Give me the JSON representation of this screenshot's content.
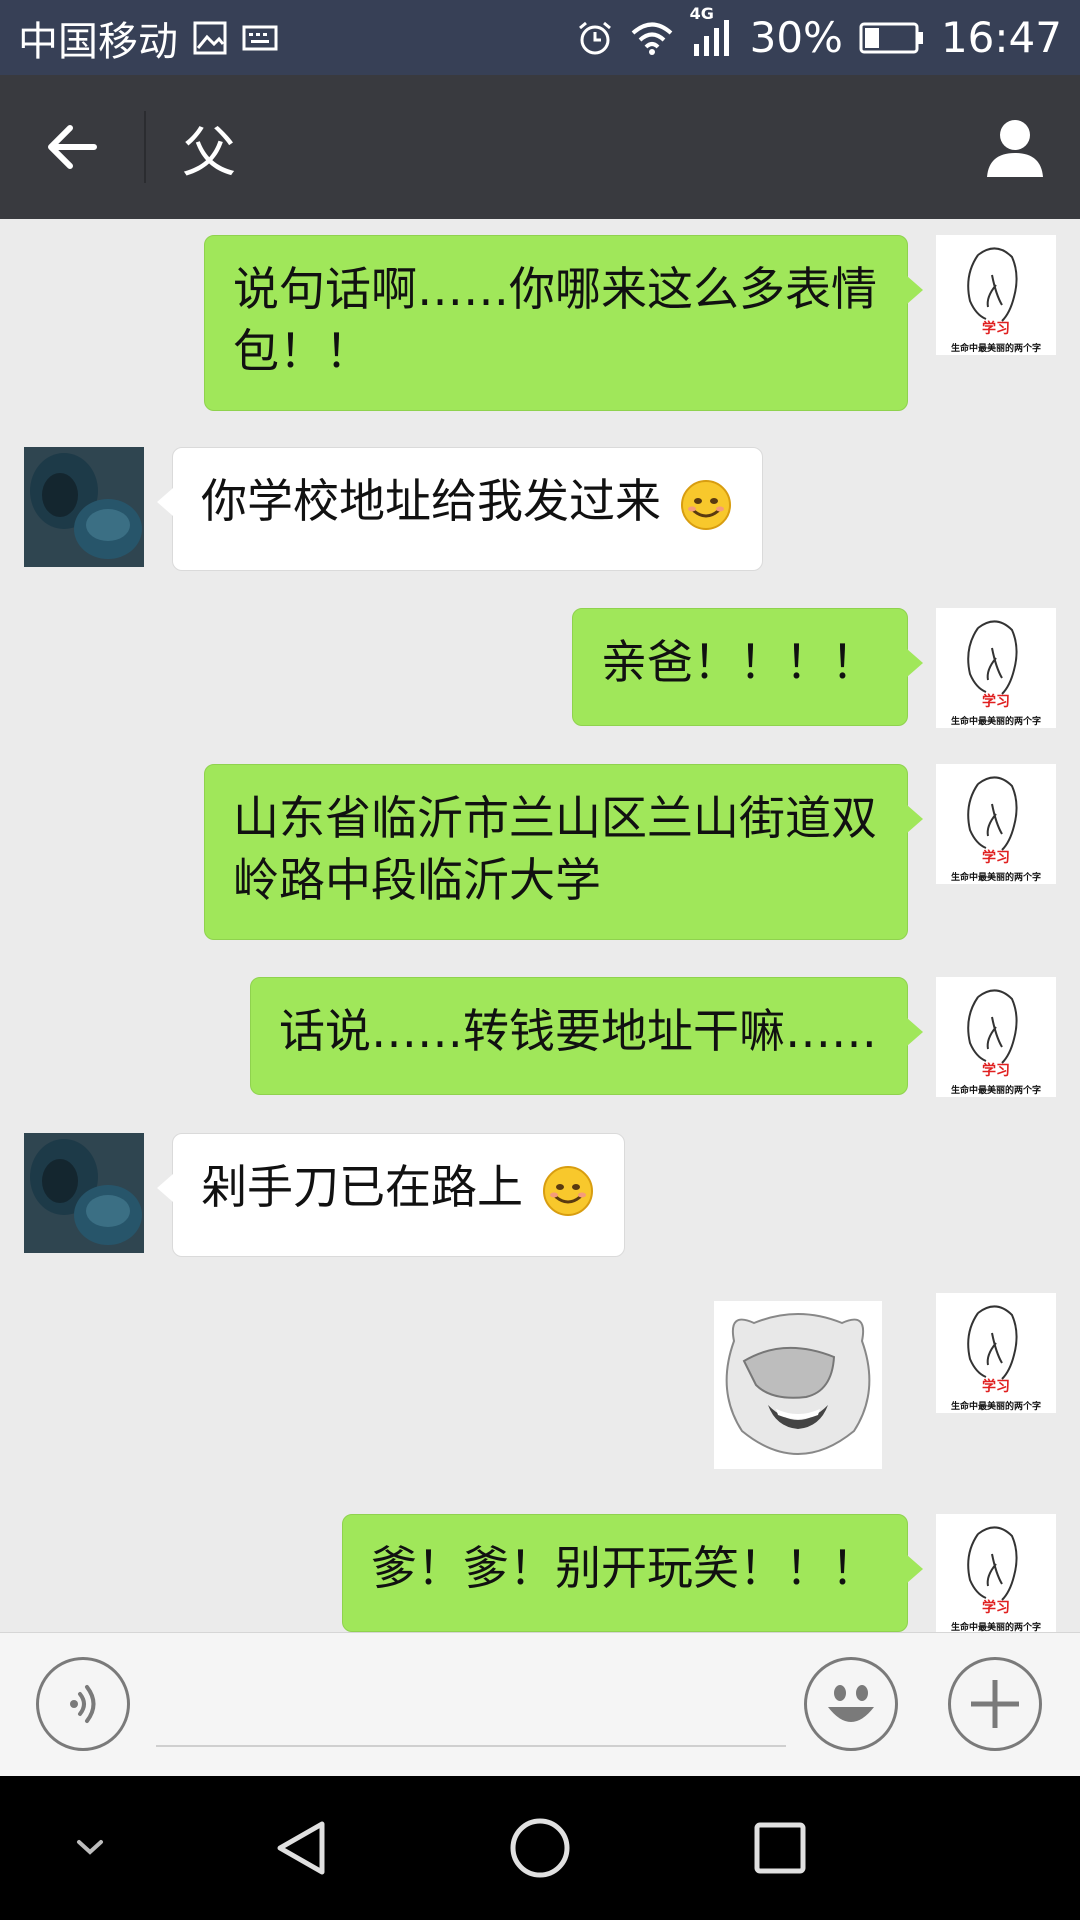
{
  "status_bar": {
    "carrier": "中国移动",
    "network": "4G",
    "battery": "30%",
    "time": "16:47"
  },
  "header": {
    "title": "父"
  },
  "messages": [
    {
      "side": "self",
      "text": "说句话啊……你哪来这么多表情包！！"
    },
    {
      "side": "other",
      "text": "你学校地址给我发过来"
    },
    {
      "side": "self",
      "text": "亲爸！！！！"
    },
    {
      "side": "self",
      "text": "山东省临沂市兰山区兰山街道双岭路中段临沂大学"
    },
    {
      "side": "self",
      "text": "话说……转钱要地址干嘛……"
    },
    {
      "side": "other",
      "text": "剁手刀已在路上"
    },
    {
      "side": "self",
      "type": "sticker"
    },
    {
      "side": "self",
      "text": "爹！爹！别开玩笑！！！"
    }
  ],
  "self_avatar": {
    "label": "学习",
    "caption": "生命中最美丽的两个字"
  },
  "colors": {
    "self_bubble": "#a0e75a",
    "other_bubble": "#ffffff",
    "title_bar": "#393a3f",
    "status_bar": "#374056",
    "chat_bg": "#ebebeb"
  }
}
